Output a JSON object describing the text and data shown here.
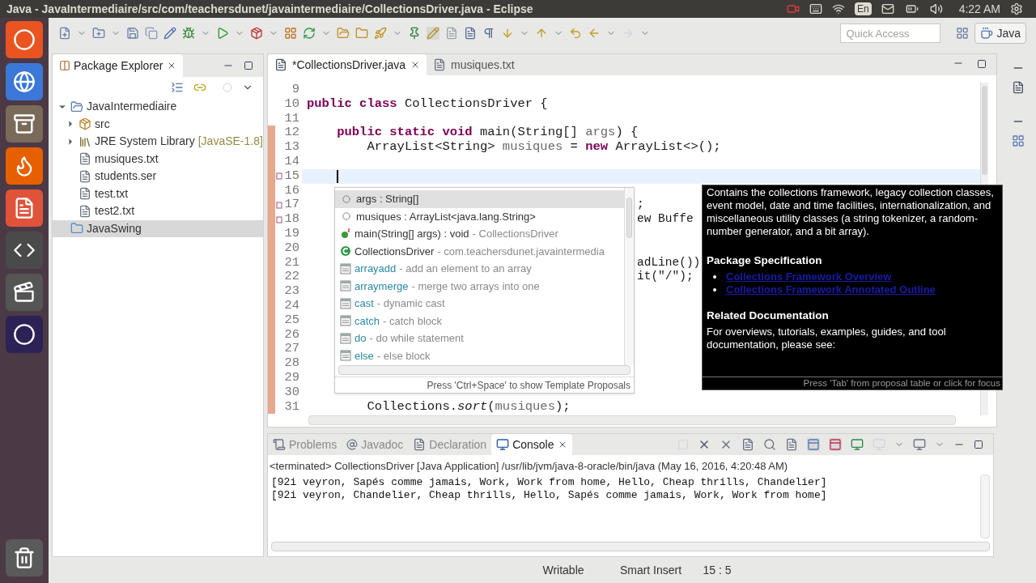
{
  "window": {
    "title": "Java - JavaIntermediaire/src/com/teachersdunet/javaintermediaire/CollectionsDriver.java - Eclipse"
  },
  "top_panel": {
    "language": "En",
    "time": "4:22 AM"
  },
  "toolbar": {
    "quick_access_placeholder": "Quick Access",
    "perspective": "Java"
  },
  "package_explorer": {
    "title": "Package Explorer",
    "items": [
      {
        "label": "JavaIntermediaire",
        "kind": "project",
        "expanded": true,
        "selected": false,
        "children": [
          {
            "label": "src",
            "kind": "source-folder",
            "expanded": false,
            "selected": false
          },
          {
            "label": "JRE System Library",
            "decoration": "[JavaSE-1.8]",
            "kind": "library",
            "expanded": false,
            "selected": false
          },
          {
            "label": "musiques.txt",
            "kind": "file",
            "selected": false
          },
          {
            "label": "students.ser",
            "kind": "file",
            "selected": false
          },
          {
            "label": "test.txt",
            "kind": "file",
            "selected": false
          },
          {
            "label": "test2.txt",
            "kind": "file",
            "selected": false
          }
        ]
      },
      {
        "label": "JavaSwing",
        "kind": "closed-project",
        "selected": true
      }
    ]
  },
  "editor": {
    "tabs": [
      {
        "label": "*CollectionsDriver.java",
        "kind": "java",
        "selected": true
      },
      {
        "label": "musiques.txt",
        "kind": "text",
        "selected": false
      }
    ],
    "lines": [
      {
        "num": "9",
        "changed": false,
        "marker": false,
        "current": false
      },
      {
        "num": "10",
        "changed": false,
        "marker": false,
        "current": false,
        "segments": [
          {
            "text": "public class",
            "kind": "keyword"
          },
          {
            "text": " CollectionsDriver {",
            "kind": "plain"
          }
        ]
      },
      {
        "num": "11",
        "changed": false,
        "marker": false,
        "current": false
      },
      {
        "num": "12",
        "changed": true,
        "marker": false,
        "current": false,
        "segments": [
          {
            "text": "    public static void",
            "kind": "keyword"
          },
          {
            "text": " main(String[] ",
            "kind": "plain"
          },
          {
            "text": "args",
            "kind": "variable"
          },
          {
            "text": ") {",
            "kind": "plain"
          }
        ]
      },
      {
        "num": "13",
        "changed": true,
        "marker": false,
        "current": false,
        "segments": [
          {
            "text": "        ArrayList<String> ",
            "kind": "plain"
          },
          {
            "text": "musiques",
            "kind": "variable"
          },
          {
            "text": " = ",
            "kind": "plain"
          },
          {
            "text": "new",
            "kind": "keyword"
          },
          {
            "text": " ArrayList<>();",
            "kind": "plain"
          }
        ]
      },
      {
        "num": "14",
        "changed": true,
        "marker": false,
        "current": false
      },
      {
        "num": "15",
        "changed": true,
        "marker": true,
        "current": true
      },
      {
        "num": "16",
        "changed": true,
        "marker": false,
        "current": false
      },
      {
        "num": "17",
        "changed": true,
        "marker": true,
        "current": false,
        "tail": ";"
      },
      {
        "num": "18",
        "changed": true,
        "marker": true,
        "current": false,
        "tail": "ew Buffe"
      },
      {
        "num": "19",
        "changed": true,
        "marker": false,
        "current": false
      },
      {
        "num": "20",
        "changed": true,
        "marker": false,
        "current": false
      },
      {
        "num": "21",
        "changed": true,
        "marker": false,
        "current": false,
        "tail": "adLine())"
      },
      {
        "num": "22",
        "changed": true,
        "marker": false,
        "current": false,
        "tail": "it(\"/\");"
      },
      {
        "num": "23",
        "changed": true,
        "marker": false,
        "current": false
      },
      {
        "num": "24",
        "changed": true,
        "marker": false,
        "current": false
      },
      {
        "num": "25",
        "changed": true,
        "marker": false,
        "current": false
      },
      {
        "num": "26",
        "changed": true,
        "marker": false,
        "current": false
      },
      {
        "num": "27",
        "changed": true,
        "marker": false,
        "current": false
      },
      {
        "num": "28",
        "changed": true,
        "marker": false,
        "current": false
      },
      {
        "num": "29",
        "changed": true,
        "marker": false,
        "current": false
      },
      {
        "num": "30",
        "changed": true,
        "marker": false,
        "current": false
      },
      {
        "num": "31",
        "changed": true,
        "marker": false,
        "current": false,
        "segments": [
          {
            "text": "        Collections.",
            "kind": "plain"
          },
          {
            "text": "sort",
            "kind": "static-method"
          },
          {
            "text": "(",
            "kind": "plain"
          },
          {
            "text": "musiques",
            "kind": "variable"
          },
          {
            "text": ");",
            "kind": "plain"
          }
        ]
      }
    ],
    "proposals": {
      "items": [
        {
          "kind": "local",
          "name": "args : String[]",
          "selected": true
        },
        {
          "kind": "local",
          "name": "musiques : ArrayList<java.lang.String>",
          "selected": false
        },
        {
          "kind": "method",
          "name": "main(String[] args) : void",
          "detail": "- CollectionsDriver",
          "selected": false
        },
        {
          "kind": "class",
          "name": "CollectionsDriver",
          "detail": "- com.teachersdunet.javaintermedia",
          "selected": false
        },
        {
          "kind": "template",
          "name": "arrayadd",
          "detail": "- add an element to an array",
          "selected": false
        },
        {
          "kind": "template",
          "name": "arraymerge",
          "detail": "- merge two arrays into one",
          "selected": false
        },
        {
          "kind": "template",
          "name": "cast",
          "detail": "- dynamic cast",
          "selected": false
        },
        {
          "kind": "template",
          "name": "catch",
          "detail": "- catch block",
          "selected": false
        },
        {
          "kind": "template",
          "name": "do",
          "detail": "- do while statement",
          "selected": false
        },
        {
          "kind": "template",
          "name": "else",
          "detail": "- else block",
          "selected": false
        }
      ],
      "footer": "Press 'Ctrl+Space' to show Template Proposals"
    },
    "javadoc": {
      "blocks": [
        {
          "kind": "text",
          "text": "Contains the collections framework, legacy collection classes, event model, date and time facilities, internationalization, and miscellaneous utility classes (a string tokenizer, a random-number generator, and a bit array)."
        },
        {
          "kind": "heading",
          "text": "Package Specification"
        },
        {
          "kind": "link",
          "text": "Collections Framework Overview"
        },
        {
          "kind": "link",
          "text": "Collections Framework Annotated Outline"
        },
        {
          "kind": "heading",
          "text": "Related Documentation"
        },
        {
          "kind": "text",
          "text": "For overviews, tutorials, examples, guides, and tool documentation, please see:"
        }
      ],
      "footer": "Press 'Tab' from proposal table or click for focus"
    }
  },
  "bottom_panel": {
    "tabs": [
      {
        "label": "Problems",
        "kind": "problems",
        "selected": false
      },
      {
        "label": "Javadoc",
        "kind": "javadoc",
        "selected": false
      },
      {
        "label": "Declaration",
        "kind": "declaration",
        "selected": false
      },
      {
        "label": "Console",
        "kind": "console",
        "selected": true
      }
    ],
    "header": "<terminated> CollectionsDriver [Java Application] /usr/lib/jvm/java-8-oracle/bin/java (May 16, 2016, 4:20:48 AM)",
    "output": [
      "[92i veyron, Sapés comme jamais, Work, Work from home, Hello, Cheap thrills, Chandelier]",
      "[92i veyron, Chandelier, Cheap thrills, Hello, Sapés comme jamais, Work, Work from home]"
    ]
  },
  "status_bar": {
    "mode": "Writable",
    "insert": "Smart Insert",
    "position": "15 : 5"
  }
}
